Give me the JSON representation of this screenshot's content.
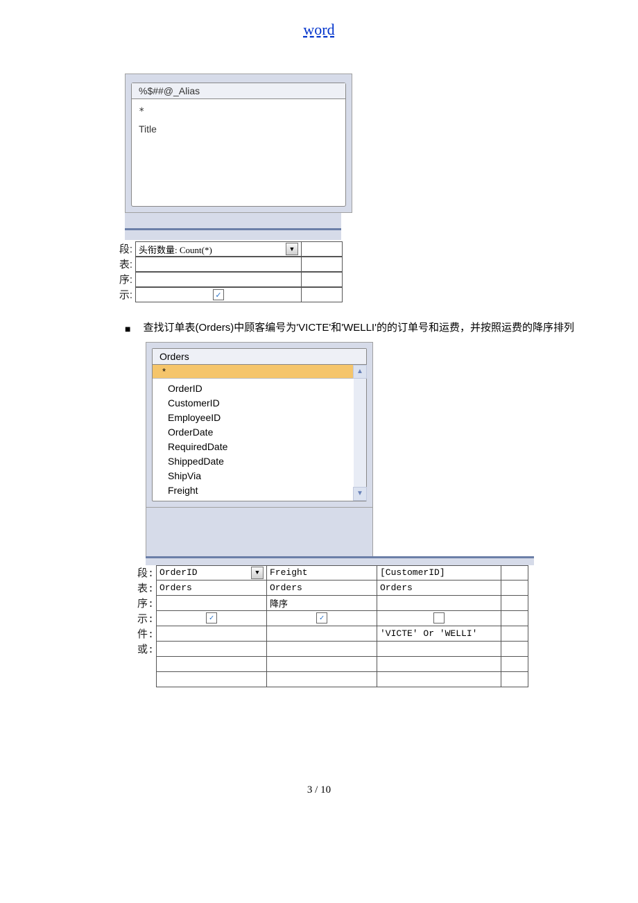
{
  "header_link": "word",
  "screenshot1": {
    "table_alias": "%$##@_Alias",
    "field_star": "*",
    "field_title": "Title",
    "grid_labels": {
      "r1": "段:",
      "r2": "表:",
      "r3": "序:",
      "r4": "示:"
    },
    "row1_field": "头衔数量: Count(*)"
  },
  "bullet_text": "查找订单表(Orders)中顾客编号为'VICTE'和'WELLI'的的订单号和运费，并按照运费的降序排列",
  "screenshot2": {
    "table_name": "Orders",
    "star": "*",
    "fields": [
      "OrderID",
      "CustomerID",
      "EmployeeID",
      "OrderDate",
      "RequiredDate",
      "ShippedDate",
      "ShipVia",
      "Freight"
    ],
    "grid_labels": {
      "r1": "段:",
      "r2": "表:",
      "r3": "序:",
      "r4": "示:",
      "r5": "件:",
      "r6": "或:"
    },
    "col1": {
      "field": "OrderID",
      "table": "Orders",
      "sort": "",
      "show": true,
      "cond": "",
      "or": ""
    },
    "col2": {
      "field": "Freight",
      "table": "Orders",
      "sort": "降序",
      "show": true,
      "cond": "",
      "or": ""
    },
    "col3": {
      "field": "[CustomerID]",
      "table": "Orders",
      "sort": "",
      "show": false,
      "cond": "'VICTE' Or 'WELLI'",
      "or": ""
    }
  },
  "page_number": "3 / 10"
}
